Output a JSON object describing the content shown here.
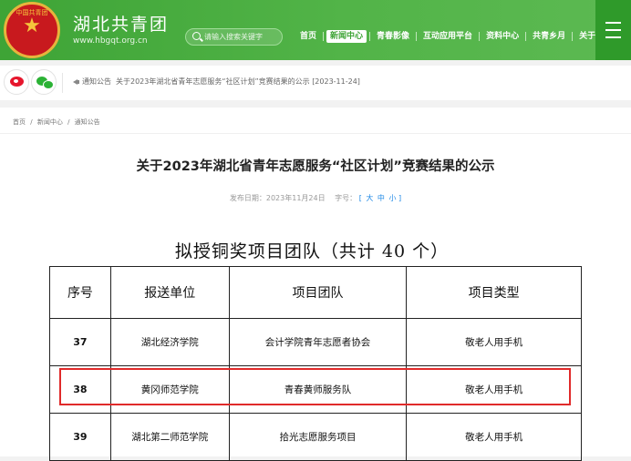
{
  "header": {
    "emblem_star": "★",
    "emblem_text": "中国共青团",
    "site_name": "湖北共青团",
    "site_url": "www.hbgqt.org.cn",
    "search_placeholder": "请输入搜索关键字",
    "nav": [
      "首页",
      "新闻中心",
      "青春影像",
      "互动应用平台",
      "资料中心",
      "共青乡月",
      "关于我们"
    ],
    "active_nav": "新闻中心"
  },
  "notice": {
    "label": "通知公告",
    "text": "关于2023年湖北省青年志愿服务“社区计划”竞赛结果的公示 [2023-11-24]"
  },
  "breadcrumb": [
    "首页",
    "/",
    "新闻中心",
    "/",
    "通知公告"
  ],
  "article": {
    "title": "关于2023年湖北省青年志愿服务“社区计划”竞赛结果的公示",
    "date_label": "发布日期：2023年11月24日",
    "size_label": "字号：",
    "sizes": [
      "大",
      "中",
      "小"
    ],
    "bracket_open": "[",
    "bracket_close": "]"
  },
  "doc": {
    "title": "拟授铜奖项目团队（共计 40 个）",
    "headers": [
      "序号",
      "报送单位",
      "项目团队",
      "项目类型"
    ],
    "rows": [
      [
        "37",
        "湖北经济学院",
        "会计学院青年志愿者协会",
        "敬老人用手机"
      ],
      [
        "38",
        "黄冈师范学院",
        "青春黄师服务队",
        "敬老人用手机"
      ],
      [
        "39",
        "湖北第二师范学院",
        "拾光志愿服务项目",
        "敬老人用手机"
      ]
    ]
  },
  "colors": {
    "header_green": "#3ea436",
    "highlight_red": "#e02a2a",
    "link_blue": "#1e88e5"
  }
}
